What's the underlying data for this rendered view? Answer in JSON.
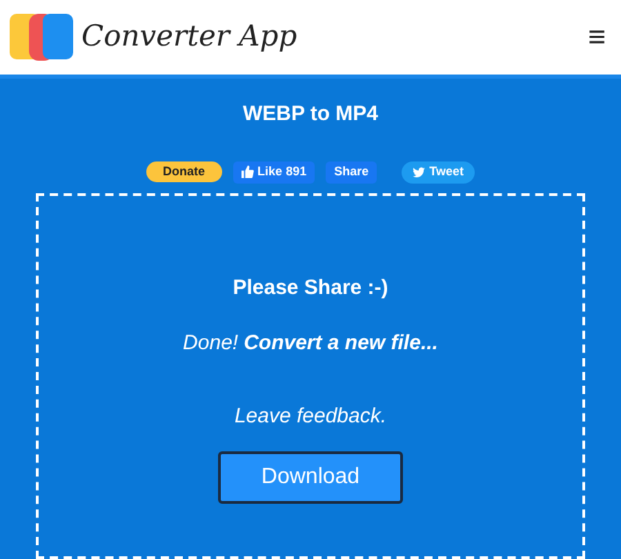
{
  "header": {
    "logo_text": "Converter App",
    "menu_icon": "≡"
  },
  "title": "WEBP to MP4",
  "social": {
    "donate": "Donate",
    "like": "Like",
    "like_count": "891",
    "share": "Share",
    "tweet": "Tweet"
  },
  "panel": {
    "heading": "Please Share :-)",
    "done": "Done!",
    "convert_link": "Convert a new file...",
    "feedback_link": "Leave feedback.",
    "download": "Download"
  }
}
